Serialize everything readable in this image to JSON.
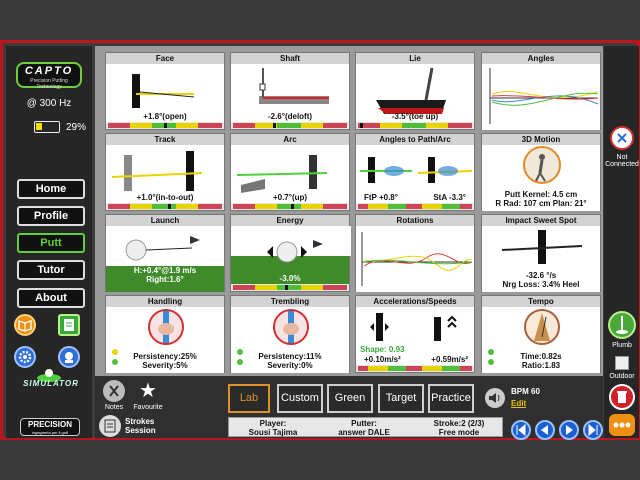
{
  "app": {
    "brand": "CAPTO",
    "tagline": "Precision Putting Technology",
    "rate": "@ 300 Hz",
    "battery_pct": "29%",
    "battery_fraction": 0.29,
    "simulator": "SIMULATOR",
    "precision": "PRECISION",
    "precision_sub": "ingegneria per il golf"
  },
  "nav": [
    "Home",
    "Profile",
    "Putt",
    "Tutor",
    "About"
  ],
  "panels": {
    "face": {
      "title": "Face",
      "value": "+1.8°(open)"
    },
    "shaft": {
      "title": "Shaft",
      "value": "-2.6°(deloft)"
    },
    "lie": {
      "title": "Lie",
      "value": "-3.5°(toe up)"
    },
    "angles": {
      "title": "Angles"
    },
    "track": {
      "title": "Track",
      "value": "+1.0°(in-to-out)"
    },
    "arc": {
      "title": "Arc",
      "value": "+0.7°(up)"
    },
    "path": {
      "title": "Angles to Path/Arc",
      "v1": "FtP +0.8°",
      "v2": "StA -3.3°"
    },
    "motion": {
      "title": "3D Motion",
      "line1": "Putt Kernel: 4.5 cm",
      "line2": "R Rad: 107 cm  Plan: 21°"
    },
    "launch": {
      "title": "Launch",
      "line1": "H:+0.4°@1.9 m/s",
      "line2": "Right:1.6°"
    },
    "energy": {
      "title": "Energy",
      "value": "-3.0%"
    },
    "rotations": {
      "title": "Rotations"
    },
    "sweet": {
      "title": "Impact Sweet Spot",
      "line1": "-32.6 °/s",
      "line2": "Nrg Loss: 3.4% Heel"
    },
    "handling": {
      "title": "Handling",
      "line1": "Persistency:25%",
      "line2": "Severity:5%"
    },
    "trembling": {
      "title": "Trembling",
      "line1": "Persistency:11%",
      "line2": "Severity:0%"
    },
    "accel": {
      "title": "Accelerations/Speeds",
      "shape": "Shape: 0.93",
      "v1": "+0.10m/s²",
      "v2": "+0.59m/s²"
    },
    "tempo": {
      "title": "Tempo",
      "line1": "Time:0.82s",
      "line2": "Ratio:1.83"
    }
  },
  "right": {
    "not_connected": "Not Connected",
    "plumb": "Plumb",
    "outdoor": "Outdoor"
  },
  "bottom": {
    "notes": "Notes",
    "favourite": "Favourite",
    "modes": [
      "Lab",
      "Custom",
      "Green",
      "Target",
      "Practice"
    ],
    "bpm": "BPM 60",
    "edit": "Edit",
    "strokes": "Strokes",
    "session": "Session",
    "player_label": "Player:",
    "player_name": "Sousi Tajima",
    "putter_label": "Putter:",
    "putter_name": "answer DALE",
    "stroke": "Stroke:2 (2/3)",
    "mode": "Free mode"
  },
  "colors": {
    "frame": "#c0141c",
    "accent_green": "#5cd13a",
    "accent_orange": "#e0902a",
    "play_blue": "#1b5fd1"
  }
}
